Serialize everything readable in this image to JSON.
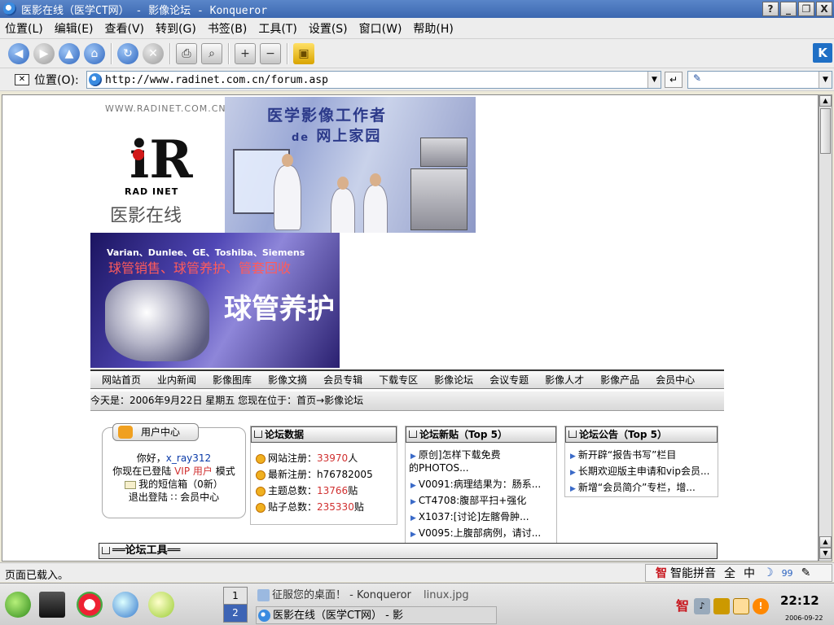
{
  "window": {
    "title": "医影在线（医学CT网） - 影像论坛 - Konqueror",
    "buttons": [
      "?",
      "_",
      "❐",
      "X"
    ]
  },
  "menubar": {
    "items": [
      "位置(L)",
      "编辑(E)",
      "查看(V)",
      "转到(G)",
      "书签(B)",
      "工具(T)",
      "设置(S)",
      "窗口(W)",
      "帮助(H)"
    ]
  },
  "toolbar": {
    "icons": [
      "back-icon",
      "forward-icon",
      "up-icon",
      "home-icon",
      "reload-icon",
      "stop-icon",
      "print-icon",
      "find-icon",
      "zoom-in-icon",
      "zoom-out-icon",
      "security-lock-icon"
    ]
  },
  "location": {
    "label": "位置(O):",
    "url": "http://www.radinet.com.cn/forum.asp"
  },
  "site": {
    "logo": {
      "ring_text": "WWW.RADINET.COM.CN",
      "mark": "iR",
      "brand": "RAD INET",
      "cn_name": "医影在线"
    },
    "banner": {
      "headline": "医学影像工作者",
      "subline_de": "de",
      "subline": "网上家园"
    },
    "ad": {
      "brands": "Varian、Dunlee、GE、Toshiba、Siemens",
      "slogan": "球管销售、球管养护、管套回收",
      "big_text": "球管养护"
    },
    "nav": [
      "网站首页",
      "业内新闻",
      "影像图库",
      "影像文摘",
      "会员专辑",
      "下载专区",
      "影像论坛",
      "会议专题",
      "影像人才",
      "影像产品",
      "会员中心"
    ],
    "breadcrumb": "今天是：2006年9月22日 星期五  您现在位于：首页→影像论坛",
    "user_center": {
      "title": "用户中心",
      "greeting_prefix": "你好，",
      "username": "x_ray312",
      "login_prefix": "你现在已登陆 ",
      "vip": "VIP 用户",
      "login_suffix": " 模式",
      "inbox": "我的短信箱（0新）",
      "logout_line": "退出登陆 ∷ 会员中心"
    },
    "forum_data": {
      "title": "论坛数据",
      "rows": [
        {
          "label": "网站注册：",
          "value": "33970",
          "unit": "人"
        },
        {
          "label": "最新注册：",
          "value": "h76782005",
          "unit": ""
        },
        {
          "label": "主题总数：",
          "value": "13766",
          "unit": "贴"
        },
        {
          "label": "贴子总数：",
          "value": "235330",
          "unit": "贴"
        }
      ]
    },
    "forum_new": {
      "title": "论坛新贴（Top 5）",
      "items": [
        "原创]怎样下载免费",
        "的PHOTOS...",
        "V0091:病理结果为：肠系...",
        "CT4708:腹部平扫+强化",
        "X1037:[讨论]左髂骨肿...",
        "V0095:上腹部病例，请讨..."
      ]
    },
    "forum_ann": {
      "title": "论坛公告（Top 5）",
      "items": [
        "新开辟“报告书写”栏目",
        "长期欢迎版主申请和vip会员...",
        "新增“会员简介”专栏，增..."
      ]
    },
    "tools_title": "══论坛工具══"
  },
  "statusbar": {
    "text": "页面已载入。",
    "ime": {
      "logo": "智",
      "name": "智能拼音",
      "full": "全",
      "lang": "中",
      "moon": "☽",
      "punct": "99",
      "pen": "✎"
    }
  },
  "taskbar": {
    "pager": [
      "1",
      "2"
    ],
    "tasks": [
      "征服您的桌面！ - Konqueror",
      "linux.jpg",
      "医影在线（医学CT网） - 影"
    ],
    "tray_logo": "智",
    "clock": "22:12",
    "date": "2006-09-22"
  },
  "colors": {
    "titlebar": "#3b67b0",
    "link_red": "#d03030",
    "link_blue": "#0a3aa8"
  }
}
